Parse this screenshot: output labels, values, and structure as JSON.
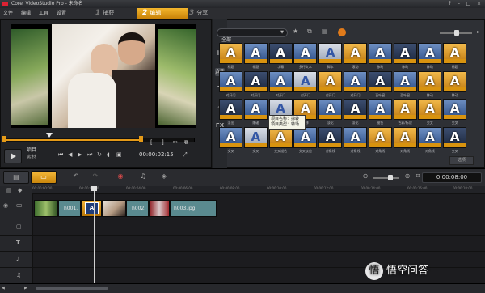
{
  "window": {
    "title": "Corel VideoStudio Pro - 未命名",
    "controls": [
      "?",
      "–",
      "□",
      "×"
    ]
  },
  "menu": {
    "items": [
      "文件",
      "编辑",
      "工具",
      "设置"
    ]
  },
  "steps": [
    {
      "num": "1",
      "label": "捕获"
    },
    {
      "num": "2",
      "label": "编辑"
    },
    {
      "num": "3",
      "label": "分享"
    }
  ],
  "preview": {
    "mode_project": "项目",
    "mode_clip": "素材",
    "timecode": "00:00:02:15",
    "bracket_in": "[",
    "bracket_out": "]"
  },
  "library": {
    "category": "全部",
    "options": "选项",
    "rows": [
      [
        "标题",
        "标题",
        "字幕",
        "多行文本",
        "脚本",
        "滚动",
        "移动",
        "移动",
        "移动",
        "标题"
      ],
      [
        "对开门",
        "对开门",
        "对开门",
        "对开门",
        "对开门",
        "对开门",
        "百叶窗",
        "百叶窗",
        "移动",
        "移动"
      ],
      [
        "淡出",
        "爆破",
        "漂移",
        "漂移",
        "淡化",
        "淡化",
        "褪色",
        "色彩/标识",
        "交叉",
        "交叉"
      ],
      [
        "交叉",
        "交叉",
        "交叉褪色",
        "交叉淡化",
        "对角线",
        "对角线",
        "对角线",
        "对角线",
        "对角线",
        "交叉"
      ]
    ],
    "tooltip_line1": "项目名称：掠转",
    "tooltip_line2": "项目类型：转场"
  },
  "timeline": {
    "timecode": "0:00:08:00",
    "ruler_ticks": [
      "00:00:00:00",
      "00:00:02:00",
      "00:00:04:00",
      "00:00:06:00",
      "00:00:08:00",
      "00:00:10:00",
      "00:00:12:00",
      "00:00:14:00",
      "00:00:16:00",
      "00:00:18:00"
    ],
    "clips": [
      {
        "label": "h001."
      },
      {
        "label": "h002."
      },
      {
        "label": "h003.jpg"
      }
    ]
  },
  "watermark": {
    "text": "悟空问答",
    "icon": "speech-bubble-icon"
  }
}
